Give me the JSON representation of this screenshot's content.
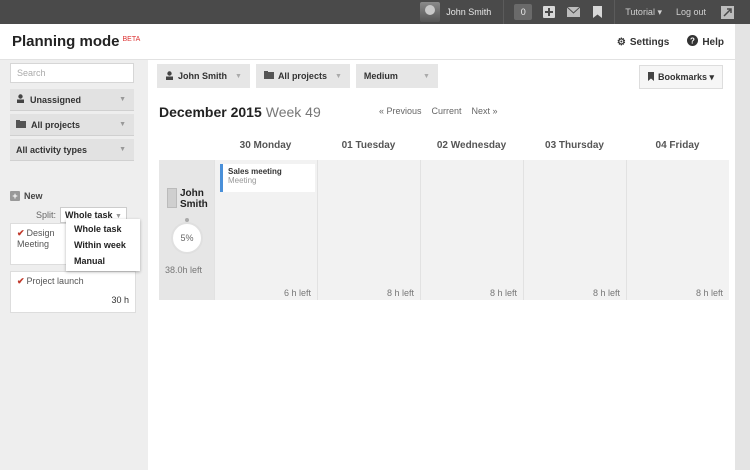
{
  "topbar": {
    "user_name": "John Smith",
    "notification_count": "0",
    "tutorial_label": "Tutorial ▾",
    "logout_label": "Log out"
  },
  "header": {
    "title": "Planning mode",
    "beta": "BETA",
    "settings_label": "Settings",
    "help_label": "Help"
  },
  "sidebar": {
    "search_placeholder": "Search",
    "filters": [
      {
        "label": "Unassigned",
        "icon": "person-icon"
      },
      {
        "label": "All projects",
        "icon": "folder-icon"
      },
      {
        "label": "All activity types",
        "icon": ""
      }
    ],
    "new_label": "New",
    "split_label": "Split:",
    "split_value": "Whole task",
    "split_options": [
      "Whole task",
      "Within week",
      "Manual"
    ],
    "tasks": [
      {
        "label": "Design Meeting",
        "line1": "Design",
        "line2": "Meeting"
      },
      {
        "label": "Project launch",
        "hours": "30 h"
      }
    ]
  },
  "toolbar": {
    "person": "John Smith",
    "projects": "All projects",
    "level": "Medium",
    "bookmarks": "Bookmarks ▾"
  },
  "calendar": {
    "month": "December 2015",
    "week": "Week 49",
    "prev": "« Previous",
    "current": "Current",
    "next": "Next »",
    "days": [
      "30 Monday",
      "01 Tuesday",
      "02 Wednesday",
      "03 Thursday",
      "04 Friday"
    ],
    "person": {
      "first": "John",
      "last": "Smith",
      "percent": "5%",
      "left": "38.0h left"
    },
    "cells_left": [
      "6 h left",
      "8 h left",
      "8 h left",
      "8 h left",
      "8 h left"
    ],
    "event": {
      "title": "Sales meeting",
      "type": "Meeting",
      "accent": "#4a90d9"
    }
  }
}
